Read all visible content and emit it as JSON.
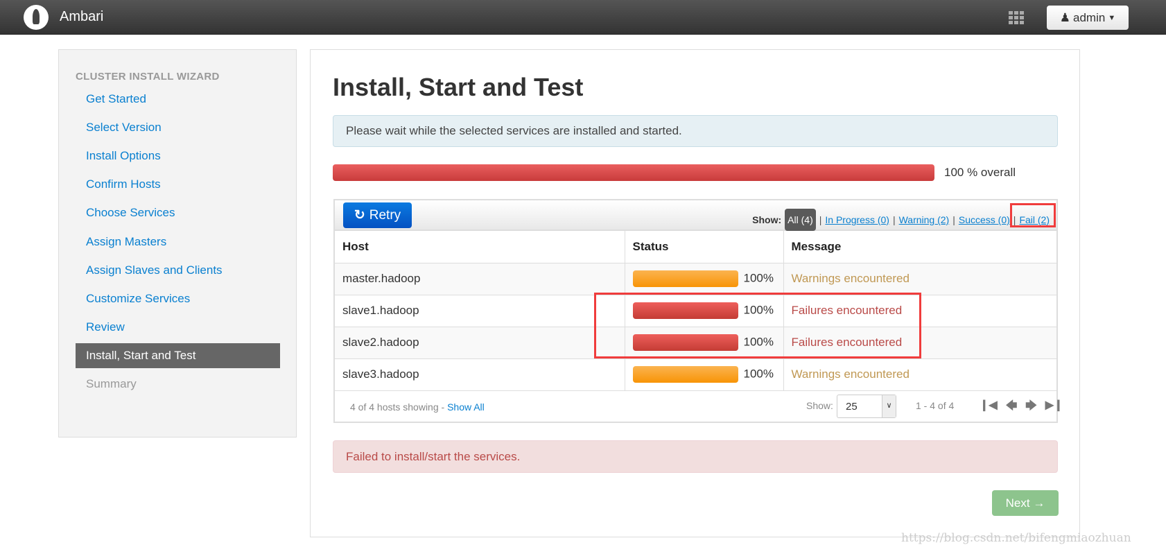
{
  "header": {
    "brand": "Ambari",
    "user": "admin",
    "icons": {
      "logo": "ambari-logo",
      "apps": "grid-icon",
      "user": "user-icon",
      "caret": "caret-down-icon"
    }
  },
  "sidebar": {
    "heading": "CLUSTER INSTALL WIZARD",
    "items": [
      {
        "label": "Get Started",
        "state": "link"
      },
      {
        "label": "Select Version",
        "state": "link"
      },
      {
        "label": "Install Options",
        "state": "link"
      },
      {
        "label": "Confirm Hosts",
        "state": "link"
      },
      {
        "label": "Choose Services",
        "state": "link"
      },
      {
        "label": "Assign Masters",
        "state": "link"
      },
      {
        "label": "Assign Slaves and Clients",
        "state": "link"
      },
      {
        "label": "Customize Services",
        "state": "link"
      },
      {
        "label": "Review",
        "state": "link"
      },
      {
        "label": "Install, Start and Test",
        "state": "active"
      },
      {
        "label": "Summary",
        "state": "disabled"
      }
    ]
  },
  "main": {
    "title": "Install, Start and Test",
    "info": "Please wait while the selected services are installed and started.",
    "overall_progress_percent": 100,
    "overall_label": "100 % overall",
    "toolbar": {
      "retry": "Retry",
      "show_label": "Show:",
      "filters": [
        {
          "label": "All (4)",
          "active": true
        },
        {
          "label": "In Progress (0)"
        },
        {
          "label": "Warning (2)"
        },
        {
          "label": "Success (0)"
        },
        {
          "label": "Fail (2)"
        }
      ]
    },
    "table": {
      "columns": [
        "Host",
        "Status",
        "Message"
      ],
      "rows": [
        {
          "host": "master.hadoop",
          "progress": "100%",
          "type": "warn",
          "message": "Warnings encountered"
        },
        {
          "host": "slave1.hadoop",
          "progress": "100%",
          "type": "fail",
          "message": "Failures encountered"
        },
        {
          "host": "slave2.hadoop",
          "progress": "100%",
          "type": "fail",
          "message": "Failures encountered"
        },
        {
          "host": "slave3.hadoop",
          "progress": "100%",
          "type": "warn",
          "message": "Warnings encountered"
        }
      ]
    },
    "footer": {
      "showing": "4 of 4 hosts showing - ",
      "show_all": "Show All",
      "show_label": "Show:",
      "page_size": "25",
      "range": "1 - 4 of 4"
    },
    "error": "Failed to install/start the services.",
    "next": "Next →"
  },
  "colors": {
    "accent": "#0a80d0",
    "fail": "#b94a48",
    "warn": "#c09853",
    "annotation": "#f03c3c"
  },
  "watermark": "https://blog.csdn.net/bifengmiaozhuan"
}
